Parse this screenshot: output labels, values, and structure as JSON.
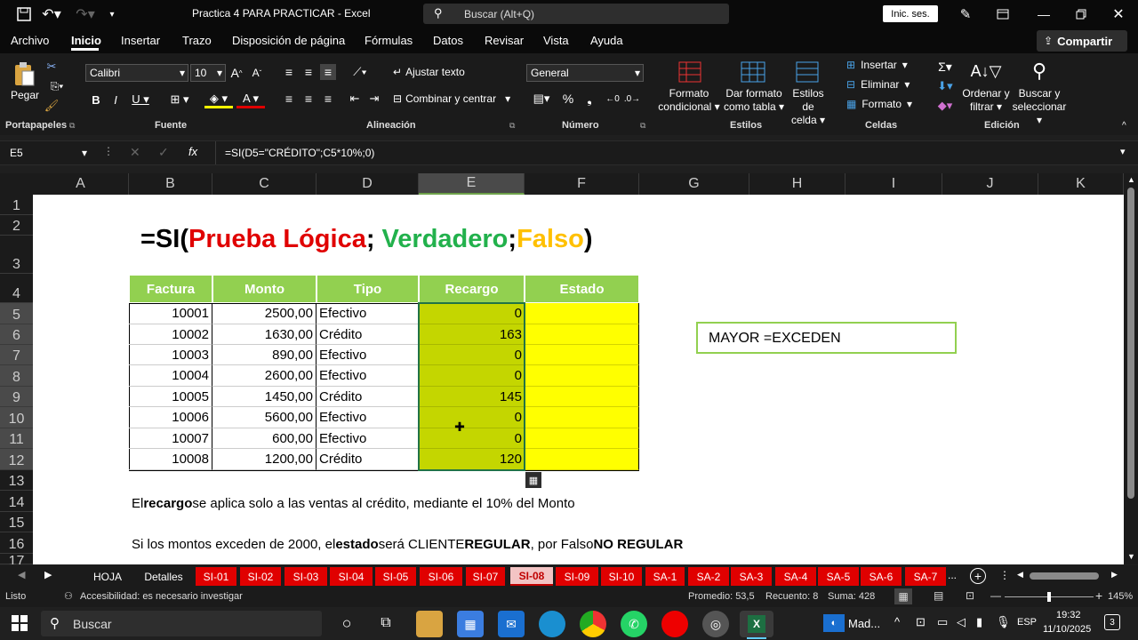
{
  "window": {
    "title": "Practica 4 PARA PRACTICAR - Excel",
    "search": "Buscar (Alt+Q)",
    "signin": "Inic. ses."
  },
  "menu": [
    "Archivo",
    "Inicio",
    "Insertar",
    "Trazo",
    "Disposición de página",
    "Fórmulas",
    "Datos",
    "Revisar",
    "Vista",
    "Ayuda"
  ],
  "share": "Compartir",
  "ribbon": {
    "paste": "Pegar",
    "font": "Calibri",
    "size": "10",
    "wrap": "Ajustar texto",
    "merge": "Combinar y centrar",
    "numfmt": "General",
    "cond1": "Formato",
    "cond2": "condicional",
    "tbl1": "Dar formato",
    "tbl2": "como tabla",
    "sty1": "Estilos de",
    "sty2": "celda",
    "insert": "Insertar",
    "delete": "Eliminar",
    "format": "Formato",
    "sort1": "Ordenar y",
    "sort2": "filtrar",
    "find1": "Buscar y",
    "find2": "seleccionar",
    "groups": [
      "Portapapeles",
      "Fuente",
      "Alineación",
      "Número",
      "Estilos",
      "Celdas",
      "Edición"
    ]
  },
  "formula_bar": {
    "cell": "E5",
    "formula": "=SI(D5=\"CRÉDITO\";C5*10%;0)"
  },
  "columns": [
    "A",
    "B",
    "C",
    "D",
    "E",
    "F",
    "G",
    "H",
    "I",
    "J",
    "K"
  ],
  "rows": [
    "1",
    "2",
    "3",
    "4",
    "5",
    "6",
    "7",
    "8",
    "9",
    "10",
    "11",
    "12",
    "13",
    "14",
    "15",
    "16",
    "17"
  ],
  "sheet": {
    "title_eq": "=SI(",
    "title_test": "Prueba Lógica",
    "title_sep1": "; ",
    "title_true": "Verdadero",
    "title_sep2": ";",
    "title_false": "Falso",
    "title_close": ")",
    "headers": [
      "Factura",
      "Monto",
      "Tipo",
      "Recargo",
      "Estado"
    ],
    "data": [
      [
        "10001",
        "2500,00",
        "Efectivo",
        "0"
      ],
      [
        "10002",
        "1630,00",
        "Crédito",
        "163"
      ],
      [
        "10003",
        "890,00",
        "Efectivo",
        "0"
      ],
      [
        "10004",
        "2600,00",
        "Efectivo",
        "0"
      ],
      [
        "10005",
        "1450,00",
        "Crédito",
        "145"
      ],
      [
        "10006",
        "5600,00",
        "Efectivo",
        "0"
      ],
      [
        "10007",
        "600,00",
        "Efectivo",
        "0"
      ],
      [
        "10008",
        "1200,00",
        "Crédito",
        "120"
      ]
    ],
    "note_box": "MAYOR =EXCEDEN",
    "line14_a": "El ",
    "line14_b": "recargo",
    "line14_c": " se aplica solo a las ventas al crédito, mediante el 10% del Monto",
    "line16_a": "Si los montos exceden de 2000, el ",
    "line16_b": "estado",
    "line16_c": " será CLIENTE ",
    "line16_d": "REGULAR",
    "line16_e": ", por Falso ",
    "line16_f": "NO REGULAR"
  },
  "sheet_tabs": [
    "HOJA",
    "Detalles",
    "SI-01",
    "SI-02",
    "SI-03",
    "SI-04",
    "SI-05",
    "SI-06",
    "SI-07",
    "SI-08",
    "SI-09",
    "SI-10",
    "SA-1",
    "SA-2",
    "SA-3",
    "SA-4",
    "SA-5",
    "SA-6",
    "SA-7"
  ],
  "status": {
    "ready": "Listo",
    "access": "Accesibilidad: es necesario investigar",
    "avg": "Promedio: 53,5",
    "count": "Recuento: 8",
    "sum": "Suma: 428",
    "zoom": "145%"
  },
  "taskbar": {
    "search": "Buscar",
    "weather": "Mad...",
    "lang": "ESP",
    "time": "19:32",
    "date": "11/10/2025",
    "notif": "3"
  },
  "colors": {
    "green_header": "#92d050",
    "recargo": "#c4d600",
    "estado": "#ffff00",
    "tab_red": "#e00000",
    "test": "#e00000",
    "true": "#22b14c",
    "false": "#ffc000"
  }
}
